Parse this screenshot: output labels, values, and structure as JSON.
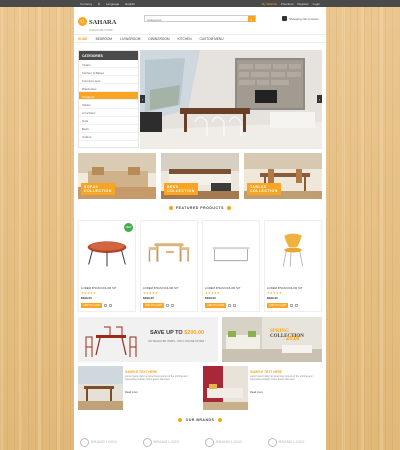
{
  "topbar": {
    "currency_label": "Currency",
    "currency_value": "$",
    "language_label": "Language",
    "language_value": "English",
    "links": [
      "My Wishlist",
      "Checkout",
      "Register",
      "Login"
    ]
  },
  "header": {
    "logo_name": "SAHARA",
    "logo_tag": "FURNITURE STORE",
    "search_category": "Categories",
    "cart_text": "Shopping cart is Items"
  },
  "nav": {
    "items": [
      "HOME",
      "BEDROOM",
      "LIVINGROOM",
      "DININGROOM",
      "KITCHEN",
      "CUSTOM MENU"
    ]
  },
  "sidebar": {
    "header": "CATEGORIES",
    "items": [
      "Chairs",
      "Kitchen & Bakes",
      "Furniture sets",
      "Wardrobes",
      "Outdoors",
      "Tables",
      "Armchairs",
      "Sofa",
      "Beds",
      "Cabins"
    ],
    "active_index": 4
  },
  "collections": [
    {
      "line1": "SOFAS",
      "line2": "COLLECTION"
    },
    {
      "line1": "BEDS",
      "line2": "COLLECTION"
    },
    {
      "line1": "TABLES",
      "line2": "COLLECTION"
    }
  ],
  "featured": {
    "title": "FEATURED PRODUCTS",
    "products": [
      {
        "title": "LOREM IPSUM DOLOR SIT",
        "price": "$399.00",
        "new": "NEW",
        "add": "ADD TO CART"
      },
      {
        "title": "LOREM IPSUM DOLOR SIT",
        "price": "$399.00",
        "new": "",
        "add": "ADD TO CART"
      },
      {
        "title": "LOREM IPSUM DOLOR SIT",
        "price": "$399.00",
        "new": "",
        "add": "ADD TO CART"
      },
      {
        "title": "LOREM IPSUM DOLOR SIT",
        "price": "$399.00",
        "new": "",
        "add": "ADD TO CART"
      }
    ],
    "rating_stars": "★★★★★"
  },
  "promo": {
    "save_prefix": "SAVE UP TO ",
    "save_amount": "$200.00",
    "sub": "ON SELECTED ITEMS - ONLY ONLINE STORE !",
    "spring_a": "SPRING ",
    "spring_b": "COLLECTION",
    "year": "2016"
  },
  "blogs": [
    {
      "title": "SAMPLE TEXT HERE",
      "desc": "Lorem ipsum dolor sit amet lorem ipsum of the printing and typesetting industry lorem ipsum has been",
      "more": "Read more"
    },
    {
      "title": "SAMPLE TEXT HERE",
      "desc": "Lorem ipsum dolor sit amet lorem ipsum of the printing and typesetting industry lorem ipsum has been",
      "more": "Read more"
    }
  ],
  "brands": {
    "title": "OUR BRANDS",
    "items": [
      "BRAND LOGO",
      "BRAND LOGO",
      "BRAND LOGO",
      "BRAND LOGO"
    ]
  },
  "colors": {
    "accent": "#f7a522",
    "dark": "#4a4a4a",
    "new_badge": "#3fae49"
  }
}
